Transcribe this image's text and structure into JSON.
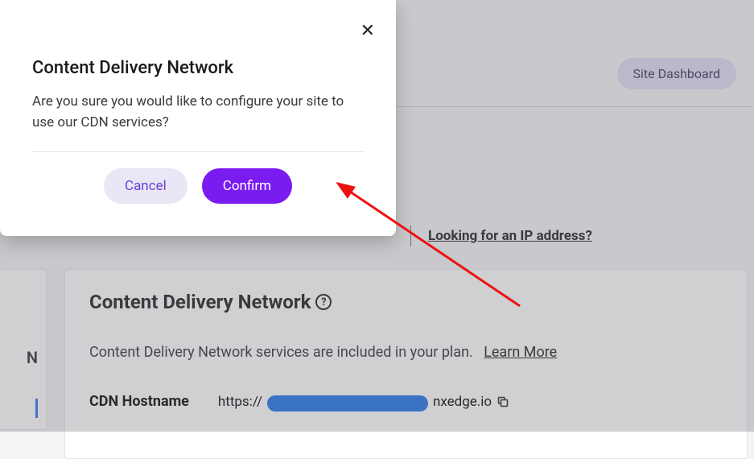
{
  "header": {
    "site_dashboard_label": "Site Dashboard"
  },
  "ip_link": "Looking for an IP address?",
  "card": {
    "title": "Content Delivery Network",
    "help_glyph": "?",
    "description": "Content Delivery Network services are included in your plan.",
    "learn_more": "Learn More",
    "hostname_label": "CDN Hostname",
    "hostname_prefix": "https://",
    "hostname_suffix": "nxedge.io"
  },
  "leftcol": {
    "letter": "N"
  },
  "modal": {
    "close_glyph": "✕",
    "title": "Content Delivery Network",
    "body": "Are you sure you would like to configure your site to use our CDN services?",
    "cancel_label": "Cancel",
    "confirm_label": "Confirm"
  }
}
